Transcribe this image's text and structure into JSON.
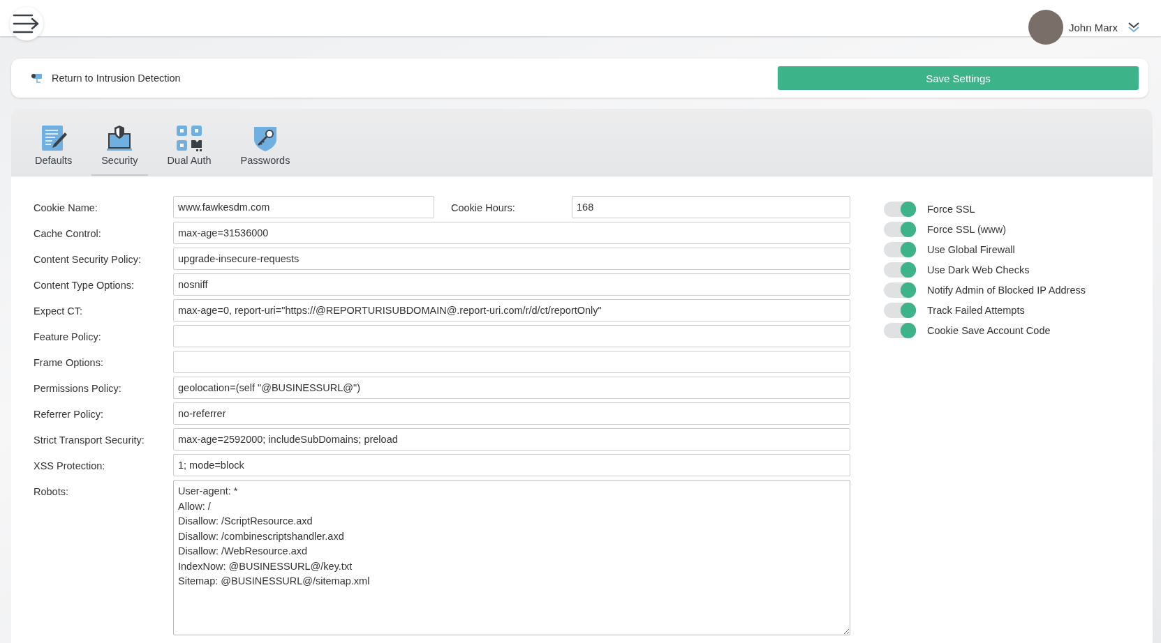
{
  "header": {
    "user_name": "John Marx"
  },
  "action_bar": {
    "return_link": "Return to Intrusion Detection",
    "save_button": "Save Settings"
  },
  "tabs": [
    {
      "label": "Defaults",
      "kind": "defaults",
      "selected": false
    },
    {
      "label": "Security",
      "kind": "security",
      "selected": true
    },
    {
      "label": "Dual Auth",
      "kind": "dualauth",
      "selected": false
    },
    {
      "label": "Passwords",
      "kind": "passwords",
      "selected": false
    }
  ],
  "first_row": [
    {
      "label": "Cookie Name:",
      "value": "www.fawkesdm.com"
    },
    {
      "label": "Cookie Hours:",
      "value": "168"
    }
  ],
  "fields": [
    {
      "label": "Cache Control:",
      "value": "max-age=31536000"
    },
    {
      "label": "Content Security Policy:",
      "value": "upgrade-insecure-requests"
    },
    {
      "label": "Content Type Options:",
      "value": "nosniff"
    },
    {
      "label": "Expect CT:",
      "value": "max-age=0, report-uri=\"https://@REPORTURISUBDOMAIN@.report-uri.com/r/d/ct/reportOnly\""
    },
    {
      "label": "Feature Policy:"
    },
    {
      "label": "Frame Options:"
    },
    {
      "label": "Permissions Policy:",
      "value": "geolocation=(self \"@BUSINESSURL@\")"
    },
    {
      "label": "Referrer Policy:",
      "value": "no-referrer"
    },
    {
      "label": "Strict Transport Security:",
      "value": "max-age=2592000; includeSubDomains; preload"
    },
    {
      "label": "XSS Protection:",
      "value": "1; mode=block"
    }
  ],
  "robots": {
    "label": "Robots:",
    "lines": [
      "User-agent: *",
      "Allow: /",
      "Disallow: /ScriptResource.axd",
      "Disallow: /combinescriptshandler.axd",
      "Disallow: /WebResource.axd",
      "IndexNow: @BUSINESSURL@/key.txt",
      "Sitemap: @BUSINESSURL@/sitemap.xml"
    ]
  },
  "toggles": [
    {
      "label": "Force SSL",
      "on": true
    },
    {
      "label": "Force SSL (www)",
      "on": true
    },
    {
      "label": "Use Global Firewall",
      "on": true
    },
    {
      "label": "Use Dark Web Checks",
      "on": true
    },
    {
      "label": "Notify Admin of Blocked IP Address",
      "on": true
    },
    {
      "label": "Track Failed Attempts",
      "on": true
    },
    {
      "label": "Cookie Save Account Code",
      "on": true
    }
  ]
}
